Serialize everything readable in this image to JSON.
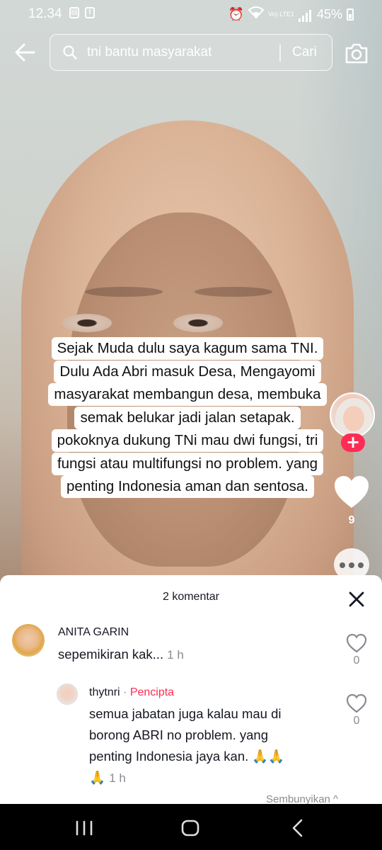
{
  "status_bar": {
    "time": "12.34",
    "battery": "45%",
    "network": "Vo) LTE1"
  },
  "search": {
    "query": "tni bantu masyarakat",
    "submit_label": "Cari"
  },
  "video": {
    "caption_lines": [
      "Sejak Muda dulu saya kagum sama TNI.",
      "Dulu Ada Abri masuk Desa, Mengayomi",
      "masyarakat membangun desa, membuka",
      "semak belukar jadi jalan setapak.",
      "pokoknya dukung TNi  mau dwi fungsi, tri",
      "fungsi atau multifungsi no problem. yang",
      "penting Indonesia aman dan sentosa."
    ],
    "like_count": "9",
    "colors": {
      "follow_accent": "#fe2c55"
    }
  },
  "comments_panel": {
    "title": "2 komentar",
    "comments": [
      {
        "username": "ANITA GARIN",
        "text": "sepemikiran kak...",
        "time": "1 h",
        "like_count": "0"
      }
    ],
    "reply": {
      "username": "thytnri",
      "separator": "·",
      "badge": "Pencipta",
      "text_lines": [
        "semua jabatan juga kalau mau di",
        "borong ABRI no problem. yang",
        "penting Indonesia jaya kan. 🙏🙏",
        "🙏"
      ],
      "time": "1 h",
      "like_count": "0"
    },
    "see_more": "Sembunyikan ^"
  },
  "icons": {
    "back": "arrow-left-icon",
    "search": "search-icon",
    "camera": "camera-icon",
    "heart": "heart-icon",
    "more": "more-icon",
    "close": "close-icon",
    "nav_recents": "recents-icon",
    "nav_home": "home-icon",
    "nav_back": "back-icon"
  }
}
